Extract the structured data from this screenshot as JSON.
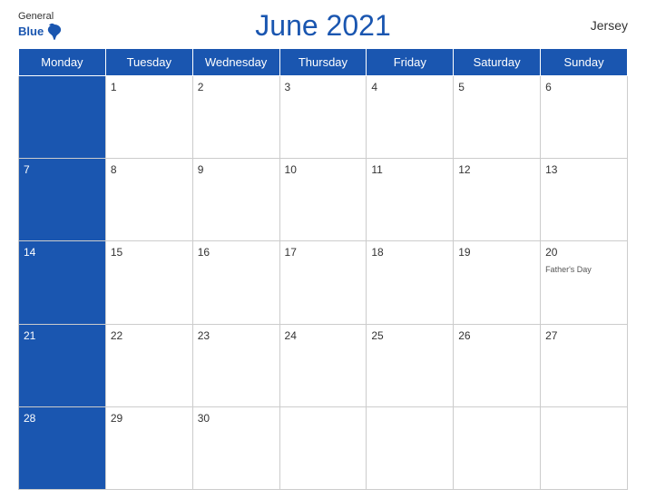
{
  "header": {
    "title": "June 2021",
    "region": "Jersey",
    "logo": {
      "line1": "General",
      "line2": "Blue"
    }
  },
  "weekdays": [
    "Monday",
    "Tuesday",
    "Wednesday",
    "Thursday",
    "Friday",
    "Saturday",
    "Sunday"
  ],
  "weeks": [
    [
      {
        "num": "",
        "event": ""
      },
      {
        "num": "1",
        "event": ""
      },
      {
        "num": "2",
        "event": ""
      },
      {
        "num": "3",
        "event": ""
      },
      {
        "num": "4",
        "event": ""
      },
      {
        "num": "5",
        "event": ""
      },
      {
        "num": "6",
        "event": ""
      }
    ],
    [
      {
        "num": "7",
        "event": ""
      },
      {
        "num": "8",
        "event": ""
      },
      {
        "num": "9",
        "event": ""
      },
      {
        "num": "10",
        "event": ""
      },
      {
        "num": "11",
        "event": ""
      },
      {
        "num": "12",
        "event": ""
      },
      {
        "num": "13",
        "event": ""
      }
    ],
    [
      {
        "num": "14",
        "event": ""
      },
      {
        "num": "15",
        "event": ""
      },
      {
        "num": "16",
        "event": ""
      },
      {
        "num": "17",
        "event": ""
      },
      {
        "num": "18",
        "event": ""
      },
      {
        "num": "19",
        "event": ""
      },
      {
        "num": "20",
        "event": "Father's Day"
      }
    ],
    [
      {
        "num": "21",
        "event": ""
      },
      {
        "num": "22",
        "event": ""
      },
      {
        "num": "23",
        "event": ""
      },
      {
        "num": "24",
        "event": ""
      },
      {
        "num": "25",
        "event": ""
      },
      {
        "num": "26",
        "event": ""
      },
      {
        "num": "27",
        "event": ""
      }
    ],
    [
      {
        "num": "28",
        "event": ""
      },
      {
        "num": "29",
        "event": ""
      },
      {
        "num": "30",
        "event": ""
      },
      {
        "num": "",
        "event": ""
      },
      {
        "num": "",
        "event": ""
      },
      {
        "num": "",
        "event": ""
      },
      {
        "num": "",
        "event": ""
      }
    ]
  ]
}
